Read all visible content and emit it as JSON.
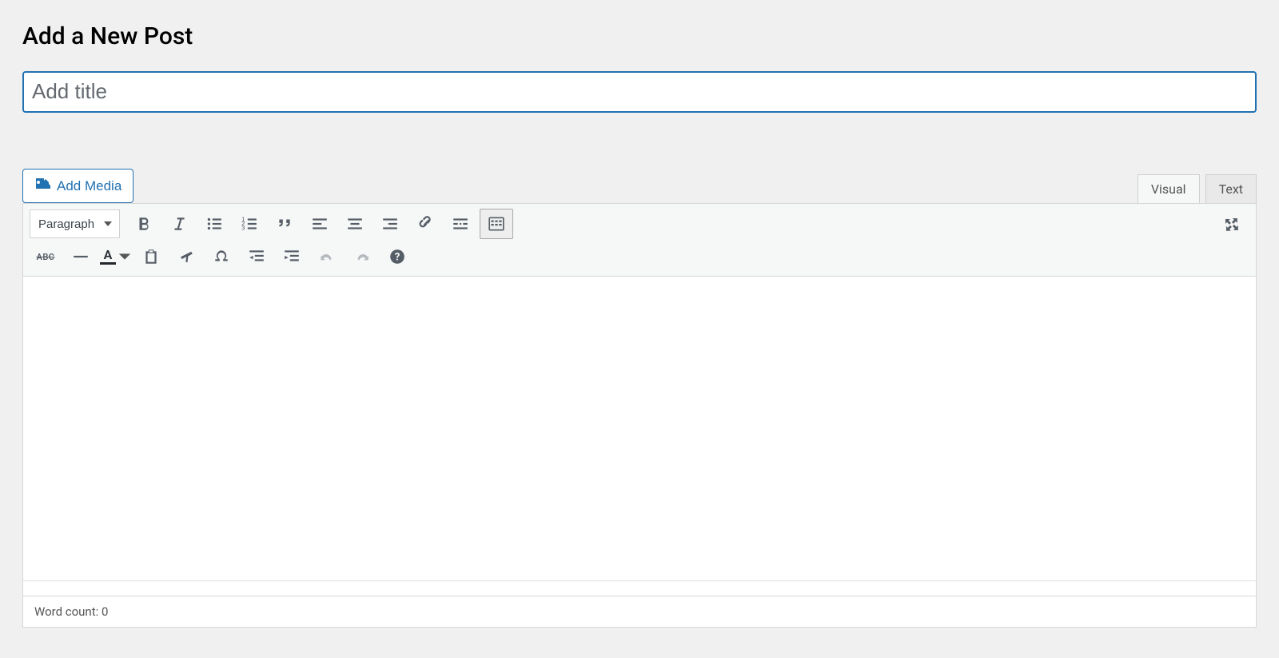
{
  "page": {
    "heading": "Add a New Post"
  },
  "title_field": {
    "placeholder": "Add title",
    "value": ""
  },
  "media_button": {
    "label": "Add Media"
  },
  "tabs": {
    "visual": "Visual",
    "text": "Text"
  },
  "format_select": {
    "value": "Paragraph"
  },
  "toolbar_row1": [
    {
      "name": "bold"
    },
    {
      "name": "italic"
    },
    {
      "name": "bullet-list"
    },
    {
      "name": "number-list"
    },
    {
      "name": "blockquote"
    },
    {
      "name": "align-left"
    },
    {
      "name": "align-center"
    },
    {
      "name": "align-right"
    },
    {
      "name": "link"
    },
    {
      "name": "read-more"
    },
    {
      "name": "toolbar-toggle",
      "active": true
    }
  ],
  "toolbar_row2": [
    {
      "name": "strikethrough"
    },
    {
      "name": "horizontal-rule"
    },
    {
      "name": "text-color"
    },
    {
      "name": "paste-text"
    },
    {
      "name": "clear-formatting"
    },
    {
      "name": "special-char"
    },
    {
      "name": "outdent"
    },
    {
      "name": "indent"
    },
    {
      "name": "undo",
      "disabled": true
    },
    {
      "name": "redo",
      "disabled": true
    },
    {
      "name": "help"
    }
  ],
  "fullscreen": {
    "name": "fullscreen"
  },
  "status": {
    "word_count_label": "Word count: ",
    "word_count": "0"
  }
}
